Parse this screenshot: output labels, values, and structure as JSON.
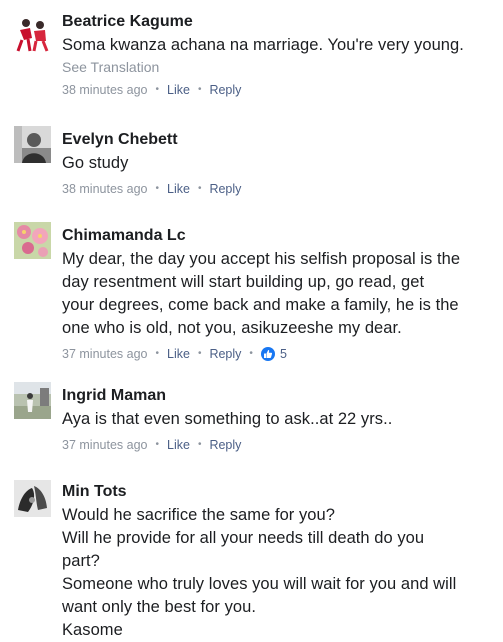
{
  "comments": [
    {
      "author": "Beatrice Kagume",
      "lines": [
        "Soma kwanza achana na marriage. You're very young."
      ],
      "see_translation": "See Translation",
      "time": "38 minutes ago",
      "like": "Like",
      "reply": "Reply",
      "avatar": "avatar-two-figures-red"
    },
    {
      "author": "Evelyn Chebett",
      "lines": [
        "Go study"
      ],
      "time": "38 minutes ago",
      "like": "Like",
      "reply": "Reply",
      "avatar": "avatar-grayscale-person"
    },
    {
      "author": "Chimamanda Lc",
      "lines": [
        "My dear, the day you accept his selfish proposal is the",
        "day resentment will start building up,  go read, get",
        "your degrees, come back and make a family,  he is the",
        "one who is old, not you, asikuzeeshe my dear."
      ],
      "time": "37 minutes ago",
      "like": "Like",
      "reply": "Reply",
      "reaction_count": "5",
      "avatar": "avatar-pink-flowers"
    },
    {
      "author": "Ingrid Maman",
      "lines": [
        "Aya is that even something to ask..at 22 yrs.."
      ],
      "time": "37 minutes ago",
      "like": "Like",
      "reply": "Reply",
      "avatar": "avatar-outdoor-photo"
    },
    {
      "author": "Min Tots",
      "lines": [
        "Would he sacrifice the same for you?",
        "Will he provide for all your needs till death do you",
        "part?",
        "Someone who truly loves you will wait for you and will",
        "want only the best for you.",
        "Kasome"
      ],
      "avatar": "avatar-bw-hands"
    }
  ],
  "colors": {
    "name": "#1c1e21",
    "meta": "#8d949e",
    "link": "#4b5f86",
    "like_badge": "#1877f2"
  }
}
